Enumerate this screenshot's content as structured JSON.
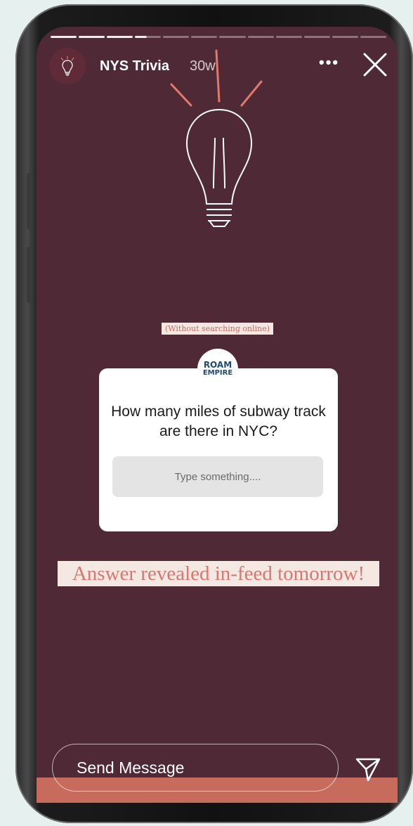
{
  "story": {
    "account_name": "NYS Trivia",
    "time_ago": "30w",
    "progress": {
      "segments": 12,
      "completed": 3
    }
  },
  "content": {
    "note": "(Without searching online)",
    "logo_line1": "ROAM",
    "logo_line2": "EMPIRE",
    "question": "How many miles of subway track are there in NYC?",
    "answer_placeholder": "Type something....",
    "reveal_text": "Answer revealed in-feed tomorrow!"
  },
  "footer": {
    "message_placeholder": "Send Message"
  },
  "colors": {
    "background": "#4f2935",
    "accent": "#e07a6a",
    "page": "#e6f0ee"
  },
  "icons": [
    "lightbulb-icon",
    "more-icon",
    "close-icon",
    "send-icon"
  ]
}
